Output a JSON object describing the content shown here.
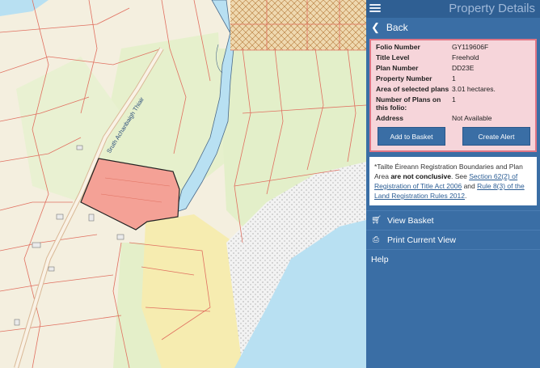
{
  "panel": {
    "title": "Property Details",
    "back_label": "Back"
  },
  "details": [
    {
      "key": "Folio Number",
      "value": "GY119606F"
    },
    {
      "key": "Title Level",
      "value": "Freehold"
    },
    {
      "key": "Plan Number",
      "value": "DD23E"
    },
    {
      "key": "Property Number",
      "value": "1"
    },
    {
      "key": "Area of selected plans",
      "value": "3.01 hectares."
    },
    {
      "key": "Number of Plans on this folio:",
      "value": "1"
    },
    {
      "key": "Address",
      "value": "Not Available"
    }
  ],
  "buttons": {
    "basket_label": "Add to Basket",
    "alert_label": "Create Alert"
  },
  "notice": {
    "text_a": "*Tailte Éireann Registration Boundaries and Plan Area ",
    "text_bold": "are not conclusive",
    "text_b": ". See ",
    "link1": "Section 62(2) of Registration of Title Act 2006",
    "text_c": " and ",
    "link2": "Rule 8(3) of the Land Registration Rules 2012",
    "text_d": "."
  },
  "menu": {
    "view_basket": "View Basket",
    "print_view": "Print Current View",
    "help": "Help"
  },
  "map": {
    "road_label": "Sruth Achanbaigh Thiair"
  },
  "colors": {
    "panel_bg": "#3a6ea5",
    "card_bg": "#f6d5da",
    "card_border": "#e07585",
    "selected_parcel": "#f4a196",
    "water": "#b8e0f2",
    "parcel_lines": "#e07060"
  }
}
